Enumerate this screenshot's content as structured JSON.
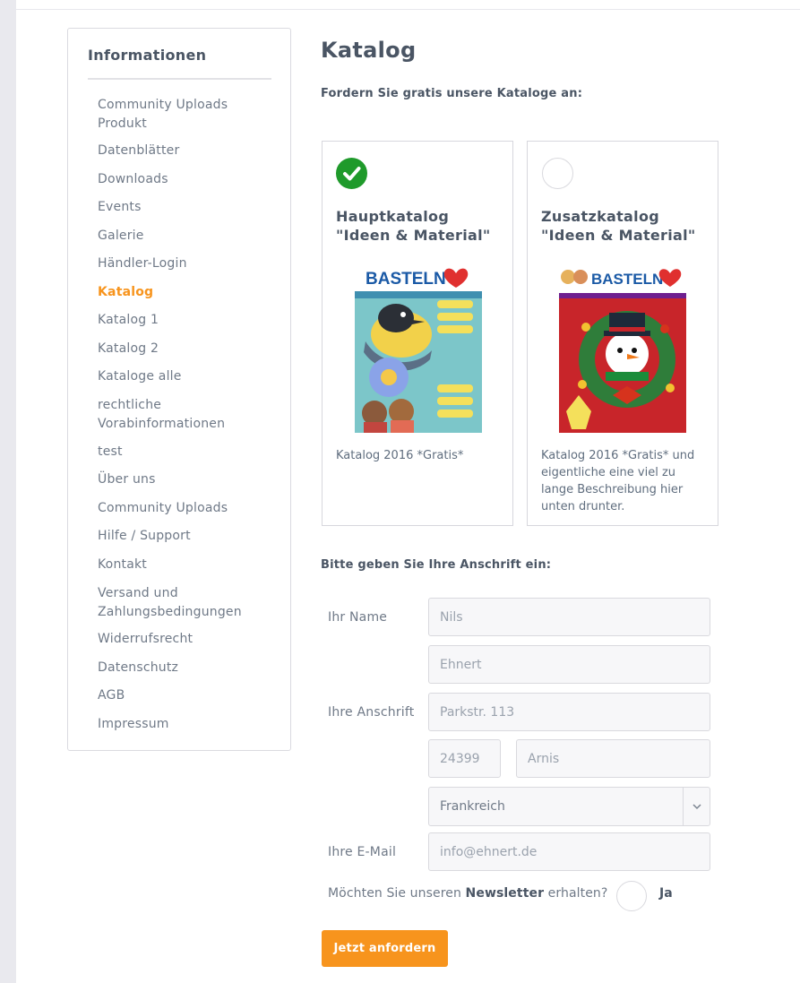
{
  "sidebar": {
    "title": "Informationen",
    "items": [
      {
        "label": "Community Uploads",
        "label2": "Produkt"
      },
      {
        "label": "Datenblätter"
      },
      {
        "label": "Downloads"
      },
      {
        "label": "Events"
      },
      {
        "label": "Galerie"
      },
      {
        "label": "Händler-Login"
      },
      {
        "label": "Katalog",
        "active": true
      },
      {
        "label": "Katalog 1"
      },
      {
        "label": "Katalog 2"
      },
      {
        "label": "Kataloge alle"
      },
      {
        "label": "rechtliche",
        "label2": "Vorabinformationen"
      },
      {
        "label": "test"
      },
      {
        "label": "Über uns"
      },
      {
        "label": "Community Uploads"
      },
      {
        "label": "Hilfe / Support"
      },
      {
        "label": "Kontakt"
      },
      {
        "label": "Versand und",
        "label2": "Zahlungsbedingungen"
      },
      {
        "label": "Widerrufsrecht"
      },
      {
        "label": "Datenschutz"
      },
      {
        "label": "AGB"
      },
      {
        "label": "Impressum"
      }
    ]
  },
  "main": {
    "title": "Katalog",
    "intro": "Fordern Sie gratis unsere Kataloge an:",
    "catalogs": [
      {
        "title_line1": "Hauptkatalog",
        "title_line2": "\"Ideen & Material\"",
        "cover_brand": "BASTELN",
        "description": "Katalog 2016 *Gratis*",
        "selected": true
      },
      {
        "title_line1": "Zusatzkatalog",
        "title_line2": "\"Ideen & Material\"",
        "cover_brand": "BASTELN",
        "description": "Katalog 2016 *Gratis* und eigentliche eine viel zu lange Beschreibung hier unten drunter.",
        "selected": false
      }
    ],
    "address_heading": "Bitte geben Sie Ihre Anschrift ein:"
  },
  "form": {
    "name_label": "Ihr Name",
    "address_label": "Ihre Anschrift",
    "email_label": "Ihre E-Mail",
    "first_name": "Nils",
    "last_name": "Ehnert",
    "street": "Parkstr. 113",
    "zip": "24399",
    "city": "Arnis",
    "country": "Frankreich",
    "email": "info@ehnert.de",
    "newsletter_prefix": "Möchten Sie unseren ",
    "newsletter_bold": "Newsletter",
    "newsletter_suffix": " erhalten?",
    "newsletter_yes": "Ja",
    "submit_label": "Jetzt anfordern"
  },
  "colors": {
    "accent": "#f7941d",
    "check": "#1f9a2b",
    "text_dark": "#4a5564",
    "text_muted": "#6f7987"
  }
}
